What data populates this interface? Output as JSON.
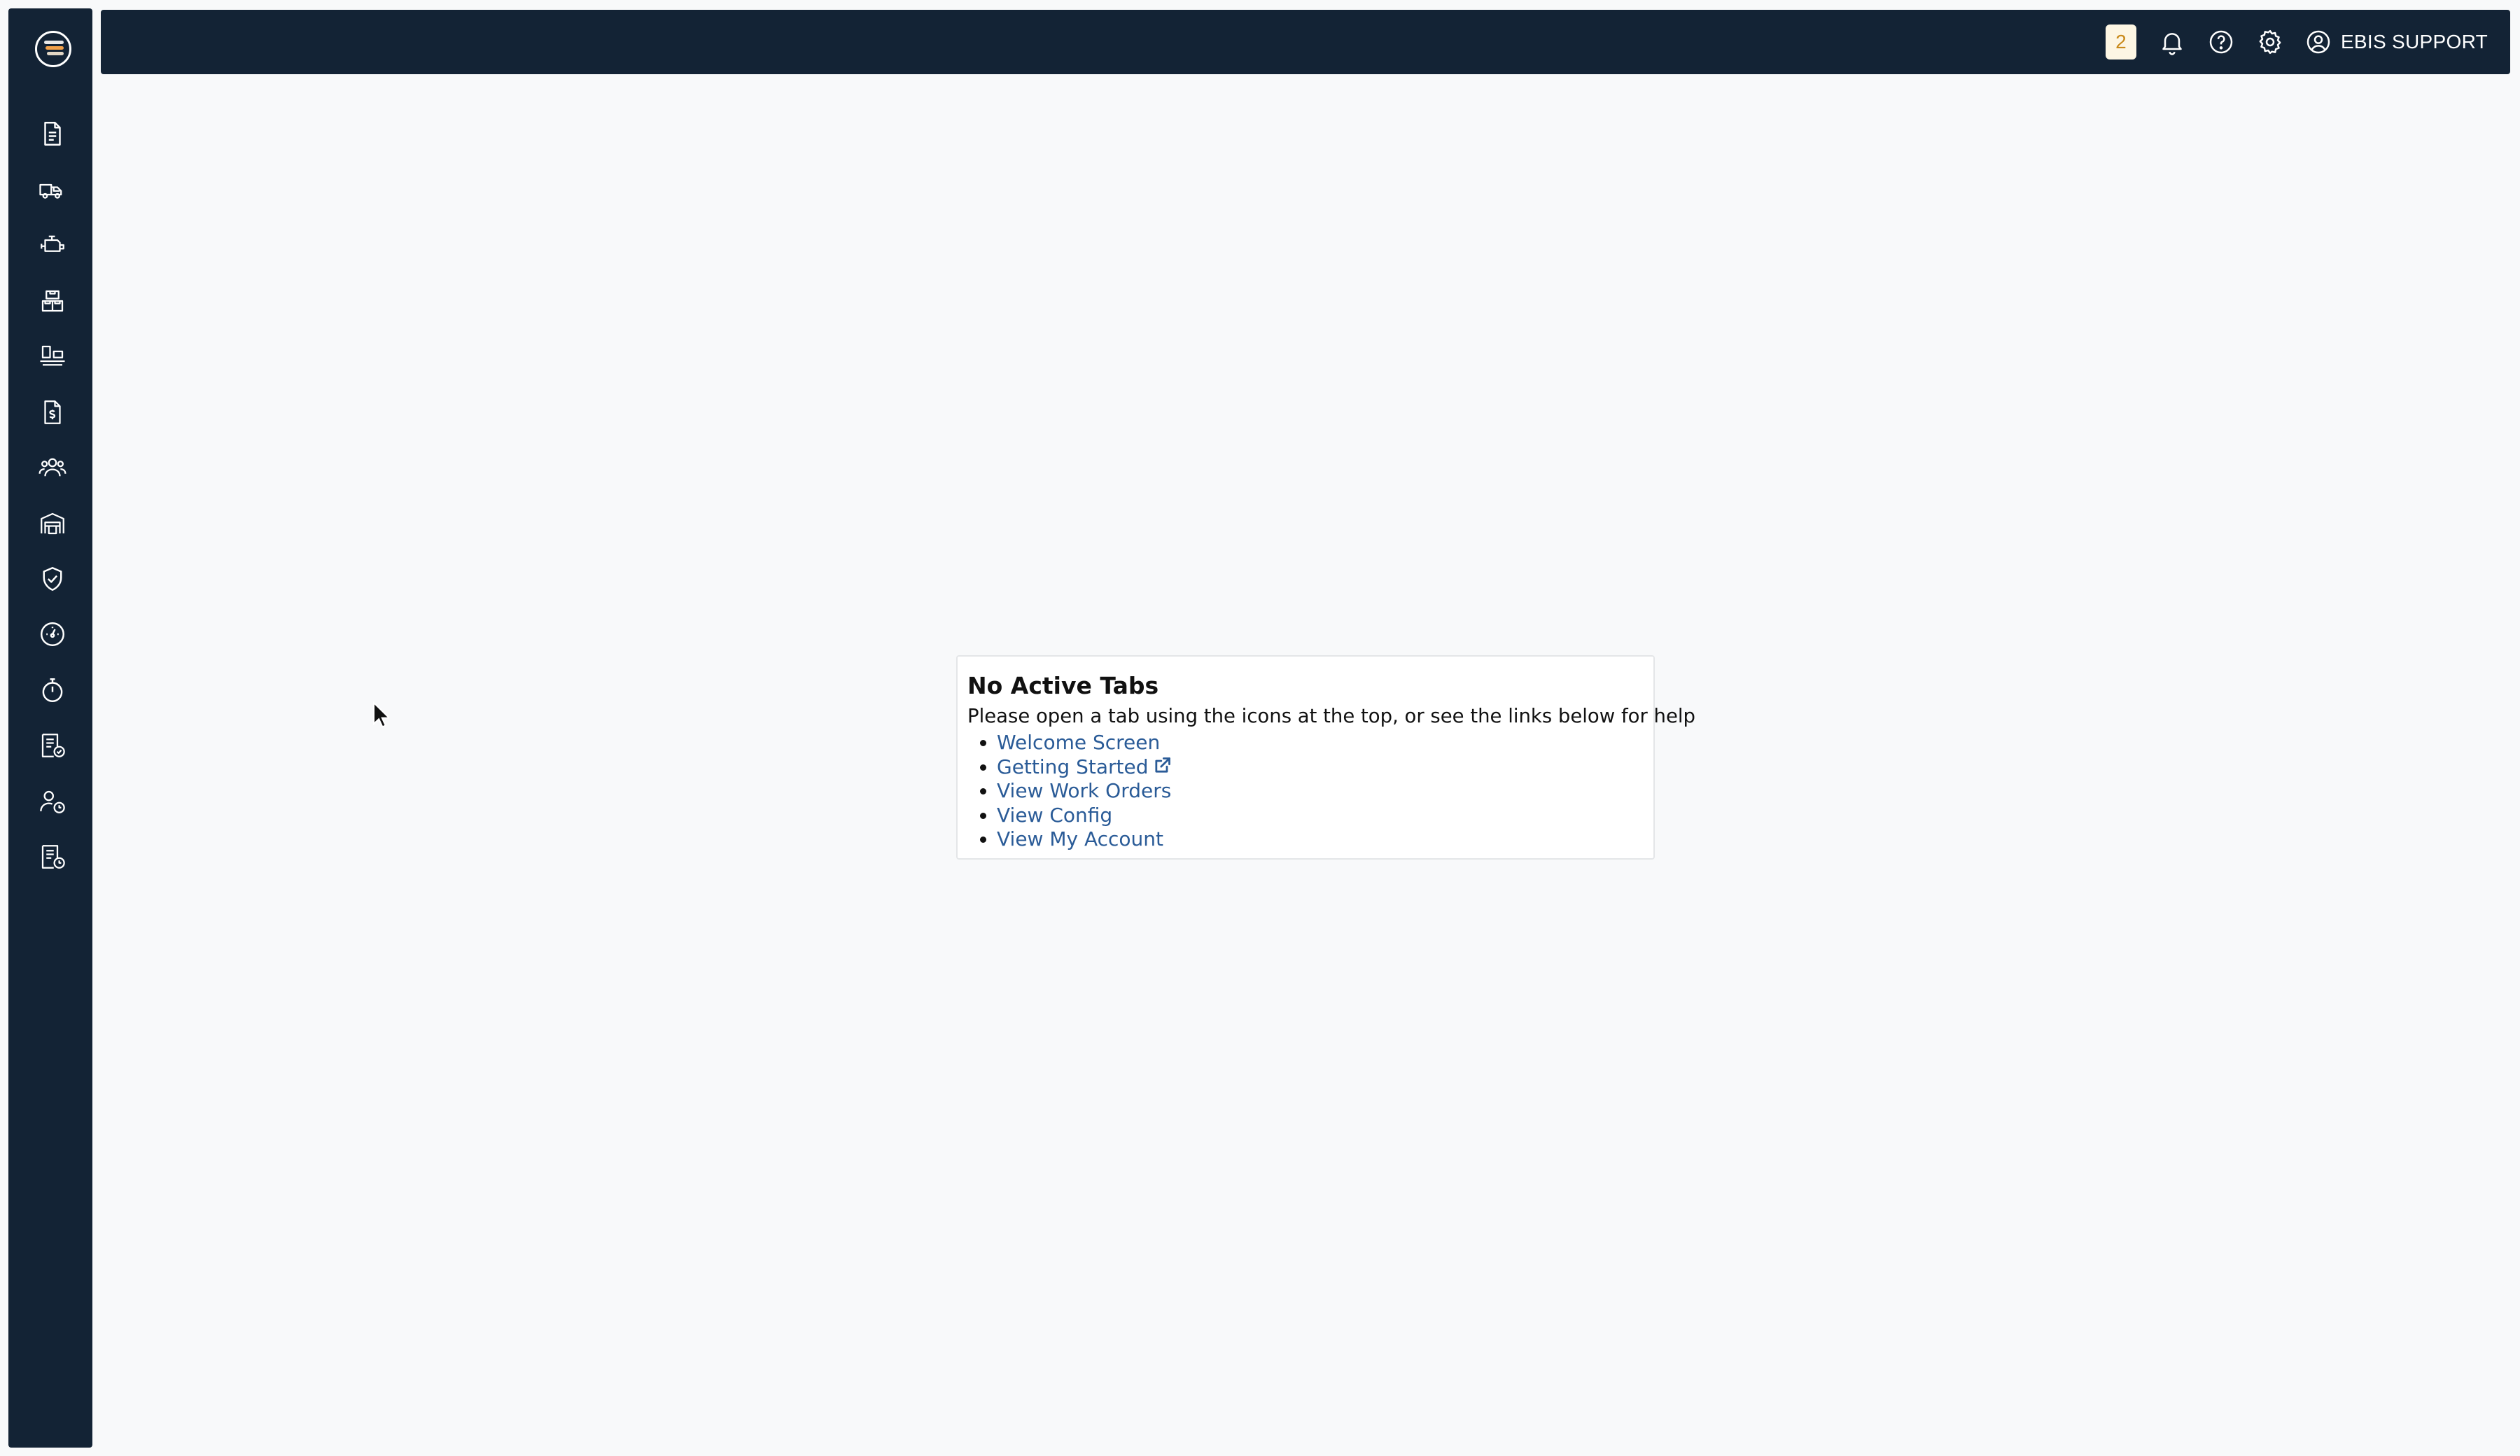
{
  "colors": {
    "chrome": "#132335",
    "background": "#f8f9fa",
    "link": "#2a5b97",
    "badge_bg": "#fdf6e4",
    "badge_text": "#c98a1b"
  },
  "logo": {
    "icon": "app-logo"
  },
  "sidebar": {
    "items": [
      {
        "icon": "document-icon"
      },
      {
        "icon": "truck-icon"
      },
      {
        "icon": "engine-icon"
      },
      {
        "icon": "boxes-icon"
      },
      {
        "icon": "equipment-icon"
      },
      {
        "icon": "invoice-dollar-icon"
      },
      {
        "icon": "users-group-icon"
      },
      {
        "icon": "warehouse-icon"
      },
      {
        "icon": "shield-check-icon"
      },
      {
        "icon": "gauge-icon"
      },
      {
        "icon": "stopwatch-icon"
      },
      {
        "icon": "checklist-icon"
      },
      {
        "icon": "user-clock-icon"
      },
      {
        "icon": "report-clock-icon"
      }
    ]
  },
  "header": {
    "notification_count": "2",
    "icons": [
      "bell-icon",
      "help-icon",
      "settings-icon",
      "user-circle-icon"
    ],
    "user_name": "EBIS SUPPORT"
  },
  "main": {
    "title": "No Active Tabs",
    "description": "Please open a tab using the icons at the top, or see the links below for help",
    "links": [
      {
        "label": "Welcome Screen",
        "external": false
      },
      {
        "label": "Getting Started",
        "external": true
      },
      {
        "label": "View Work Orders",
        "external": false
      },
      {
        "label": "View Config",
        "external": false
      },
      {
        "label": "View My Account",
        "external": false
      }
    ]
  }
}
